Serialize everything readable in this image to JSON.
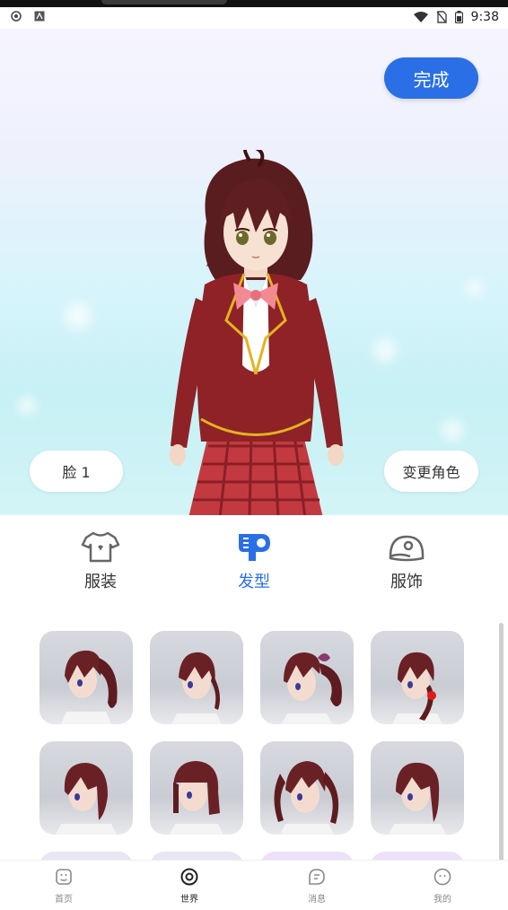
{
  "status_bar": {
    "time": "9:38"
  },
  "header": {
    "done_label": "完成"
  },
  "scene": {
    "face_label": "脸 1",
    "change_role_label": "变更角色"
  },
  "category_tabs": [
    {
      "label": "服装",
      "icon": "tshirt-icon",
      "active": false
    },
    {
      "label": "发型",
      "icon": "hair-dryer-icon",
      "active": true
    },
    {
      "label": "服饰",
      "icon": "cap-icon",
      "active": false
    }
  ],
  "hairstyles": [
    {
      "style": "side-ponytail"
    },
    {
      "style": "low-twin"
    },
    {
      "style": "high-ponytail-bow"
    },
    {
      "style": "side-braid-red-flower"
    },
    {
      "style": "short-bob"
    },
    {
      "style": "straight-bob"
    },
    {
      "style": "twin-tails"
    },
    {
      "style": "medium-layered"
    }
  ],
  "bottom_nav": [
    {
      "label": "首页",
      "icon": "home-icon"
    },
    {
      "label": "世界",
      "icon": "world-icon",
      "active": true
    },
    {
      "label": "消息",
      "icon": "message-icon"
    },
    {
      "label": "我的",
      "icon": "profile-icon"
    }
  ],
  "colors": {
    "accent": "#2b6fe6",
    "hair": "#5a1d1f",
    "jacket": "#8e2227",
    "skirt": "#c23a3f"
  }
}
